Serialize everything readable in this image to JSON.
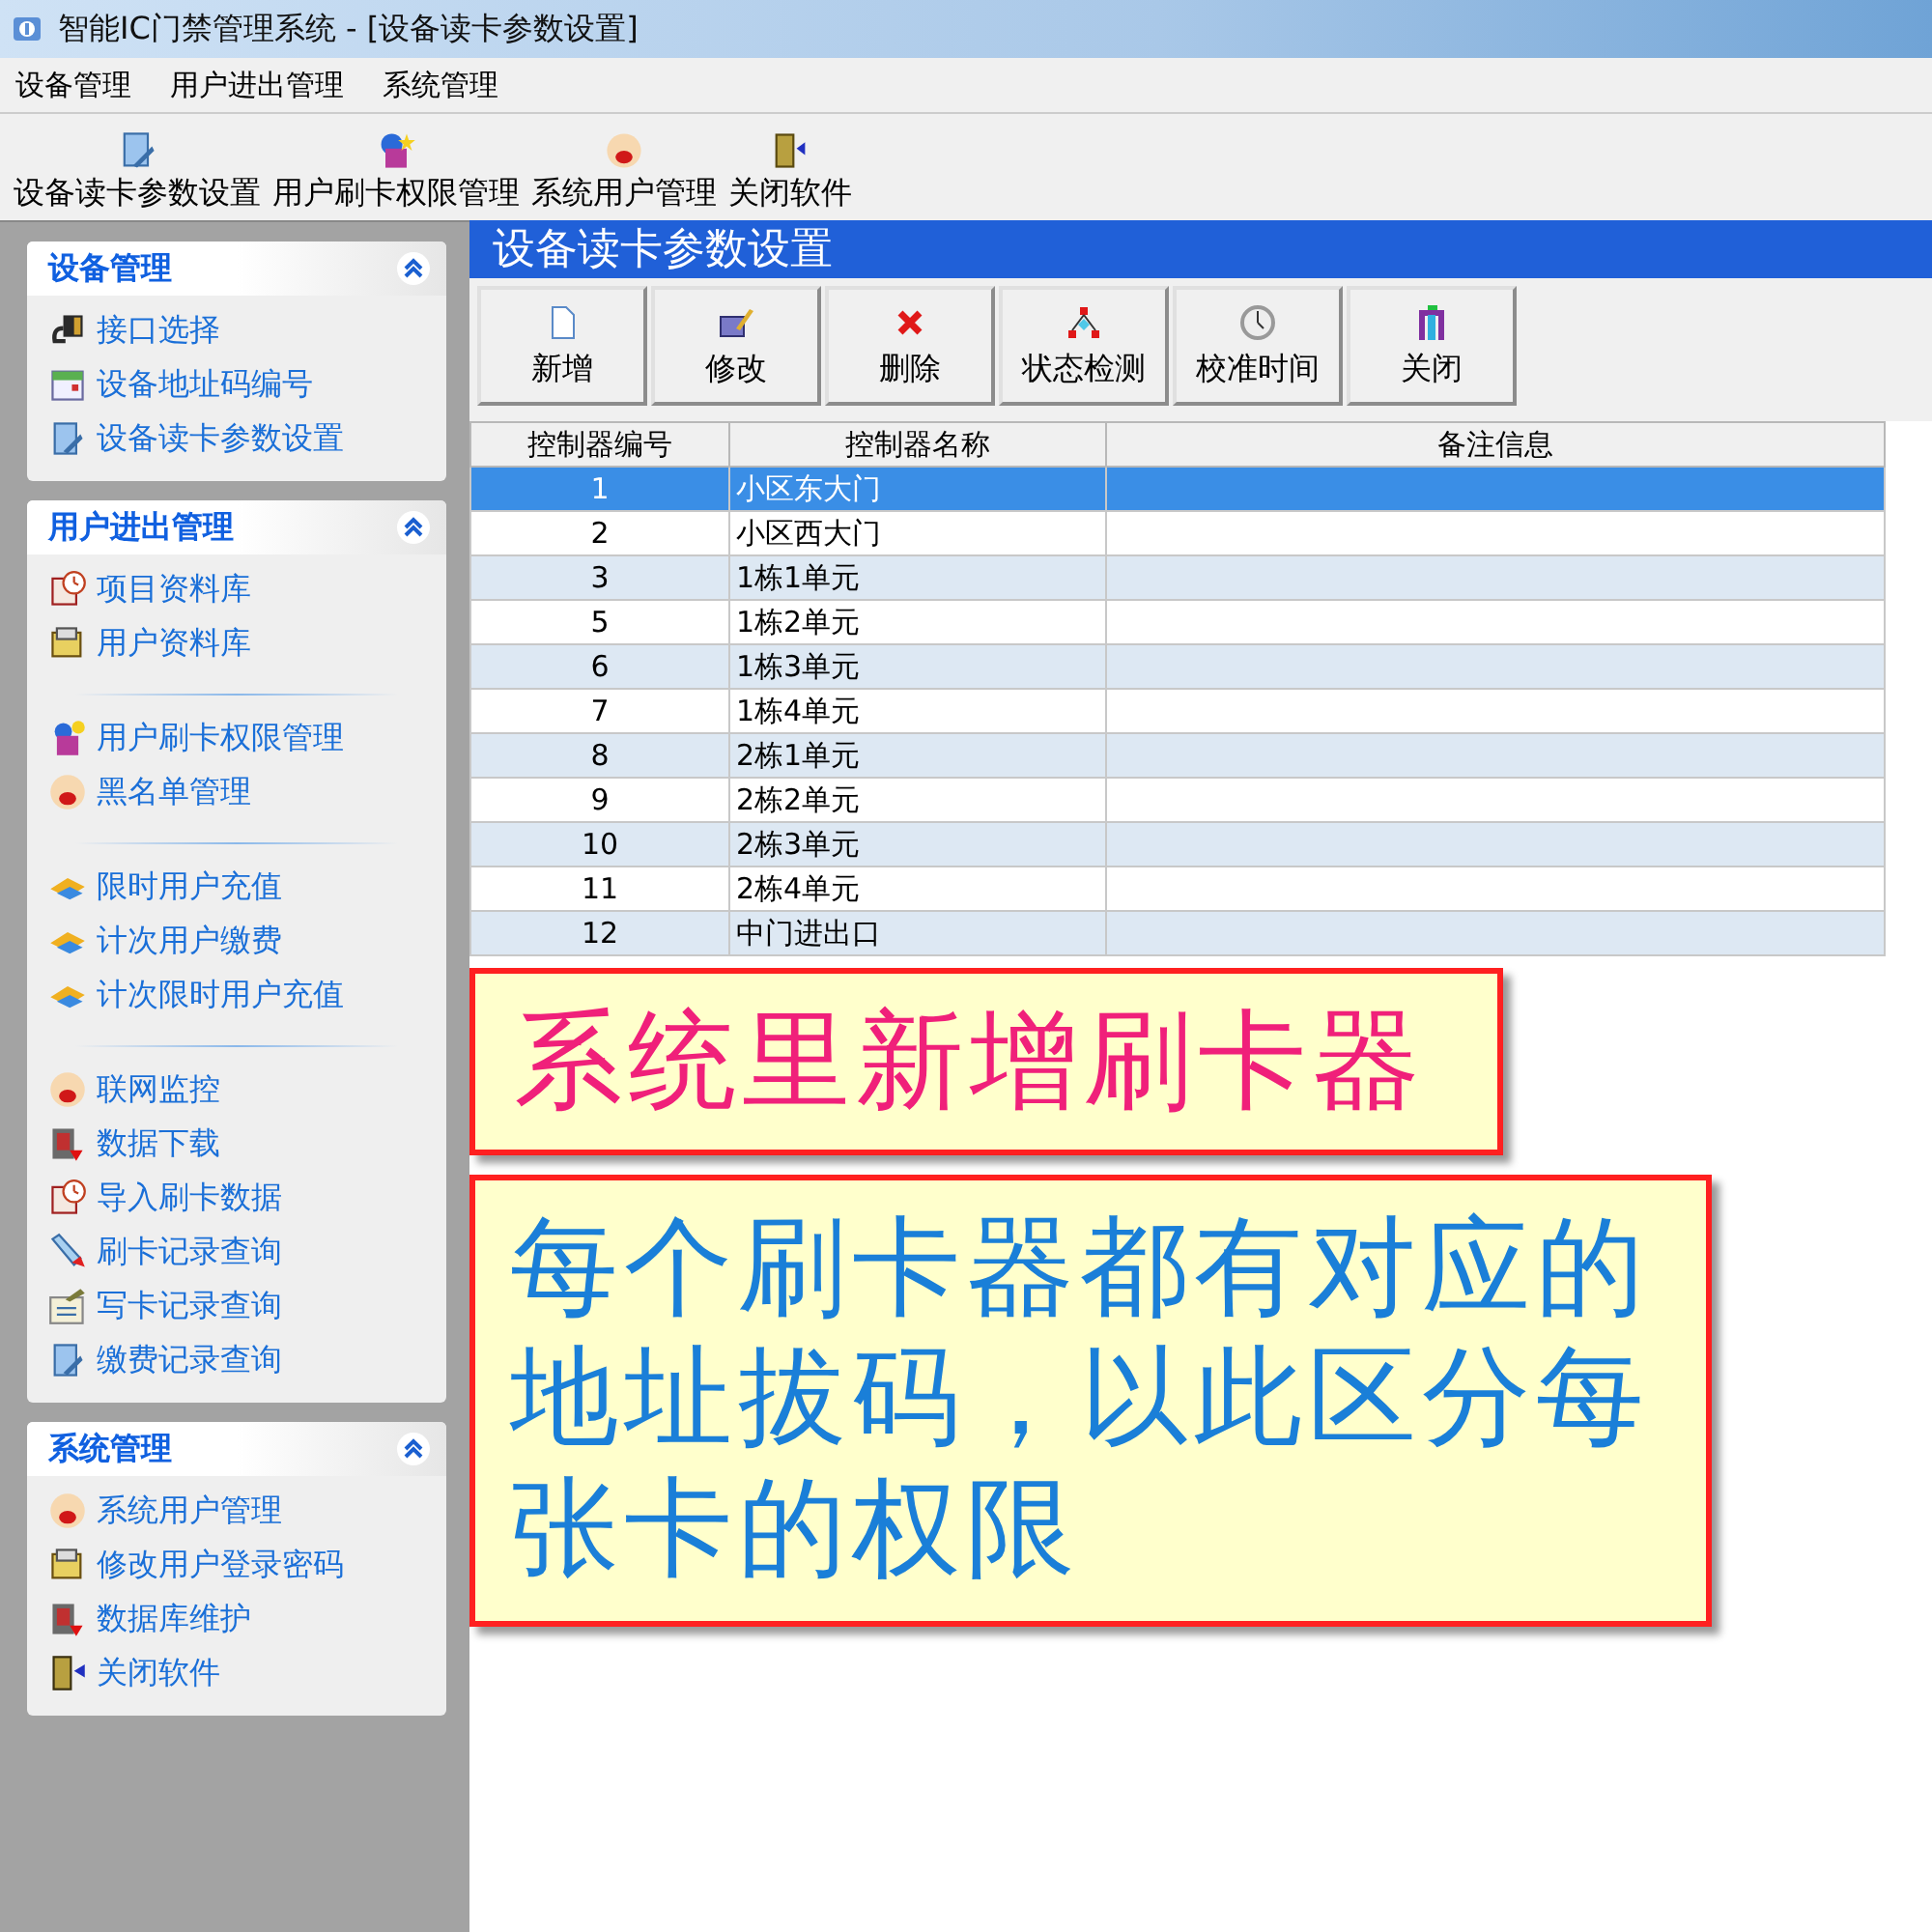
{
  "window": {
    "title": "智能IC门禁管理系统 - [设备读卡参数设置]"
  },
  "menu": [
    "设备管理",
    "用户进出管理",
    "系统管理"
  ],
  "toolbar": [
    {
      "label": "设备读卡参数设置"
    },
    {
      "label": "用户刷卡权限管理"
    },
    {
      "label": "系统用户管理"
    },
    {
      "label": "关闭软件"
    }
  ],
  "sidebar": {
    "panels": [
      {
        "title": "设备管理",
        "groups": [
          {
            "items": [
              {
                "label": "接口选择"
              },
              {
                "label": "设备地址码编号"
              },
              {
                "label": "设备读卡参数设置"
              }
            ]
          }
        ]
      },
      {
        "title": "用户进出管理",
        "groups": [
          {
            "items": [
              {
                "label": "项目资料库"
              },
              {
                "label": "用户资料库"
              }
            ]
          },
          {
            "items": [
              {
                "label": "用户刷卡权限管理"
              },
              {
                "label": "黑名单管理"
              }
            ]
          },
          {
            "items": [
              {
                "label": "限时用户充值"
              },
              {
                "label": "计次用户缴费"
              },
              {
                "label": "计次限时用户充值"
              }
            ]
          },
          {
            "items": [
              {
                "label": "联网监控"
              },
              {
                "label": "数据下载"
              },
              {
                "label": "导入刷卡数据"
              },
              {
                "label": "刷卡记录查询"
              },
              {
                "label": "写卡记录查询"
              },
              {
                "label": "缴费记录查询"
              }
            ]
          }
        ]
      },
      {
        "title": "系统管理",
        "groups": [
          {
            "items": [
              {
                "label": "系统用户管理"
              },
              {
                "label": "修改用户登录密码"
              },
              {
                "label": "数据库维护"
              },
              {
                "label": "关闭软件"
              }
            ]
          }
        ]
      }
    ]
  },
  "panel": {
    "title": "设备读卡参数设置",
    "buttons": [
      {
        "label": "新增"
      },
      {
        "label": "修改"
      },
      {
        "label": "删除"
      },
      {
        "label": "状态检测"
      },
      {
        "label": "校准时间"
      },
      {
        "label": "关闭"
      }
    ],
    "table": {
      "columns": [
        "控制器编号",
        "控制器名称",
        "备注信息"
      ],
      "rows": [
        {
          "cells": [
            "1",
            "小区东大门",
            ""
          ],
          "selected": true
        },
        {
          "cells": [
            "2",
            "小区西大门",
            ""
          ],
          "selected": false
        },
        {
          "cells": [
            "3",
            "1栋1单元",
            ""
          ],
          "selected": false
        },
        {
          "cells": [
            "5",
            "1栋2单元",
            ""
          ],
          "selected": false
        },
        {
          "cells": [
            "6",
            "1栋3单元",
            ""
          ],
          "selected": false
        },
        {
          "cells": [
            "7",
            "1栋4单元",
            ""
          ],
          "selected": false
        },
        {
          "cells": [
            "8",
            "2栋1单元",
            ""
          ],
          "selected": false
        },
        {
          "cells": [
            "9",
            "2栋2单元",
            ""
          ],
          "selected": false
        },
        {
          "cells": [
            "10",
            "2栋3单元",
            ""
          ],
          "selected": false
        },
        {
          "cells": [
            "11",
            "2栋4单元",
            ""
          ],
          "selected": false
        },
        {
          "cells": [
            "12",
            "中门进出口",
            ""
          ],
          "selected": false
        }
      ]
    }
  },
  "notes": [
    {
      "text": "系统里新增刷卡器",
      "color": "#f0207a"
    },
    {
      "text": "每个刷卡器都有对应的地址拔码，以此区分每张卡的权限",
      "color": "#1a7fd8"
    }
  ]
}
